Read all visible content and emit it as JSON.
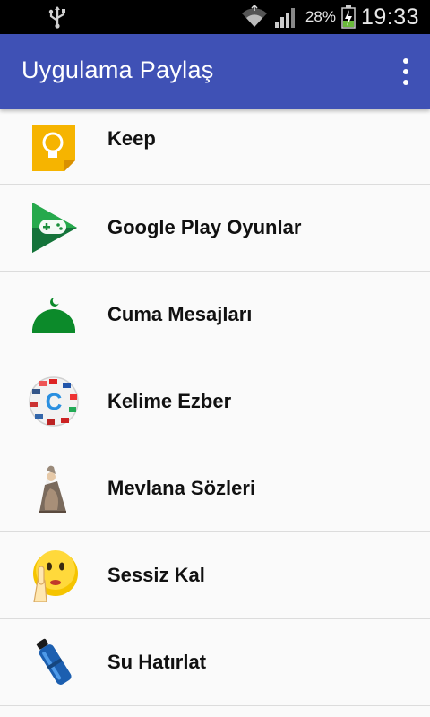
{
  "status_bar": {
    "battery": "28%",
    "time": "19:33"
  },
  "app_bar": {
    "title": "Uygulama Paylaş",
    "menu_icon": "more-vert-icon"
  },
  "apps": [
    {
      "label": "Keep",
      "icon": "keep-icon"
    },
    {
      "label": "Google Play Oyunlar",
      "icon": "google-play-games-icon"
    },
    {
      "label": "Cuma Mesajları",
      "icon": "mosque-dome-icon"
    },
    {
      "label": "Kelime Ezber",
      "icon": "flags-circle-icon"
    },
    {
      "label": "Mevlana Sözleri",
      "icon": "mevlana-figure-icon"
    },
    {
      "label": "Sessiz Kal",
      "icon": "shush-emoji-icon"
    },
    {
      "label": "Su Hatırlat",
      "icon": "water-bottle-icon"
    }
  ]
}
